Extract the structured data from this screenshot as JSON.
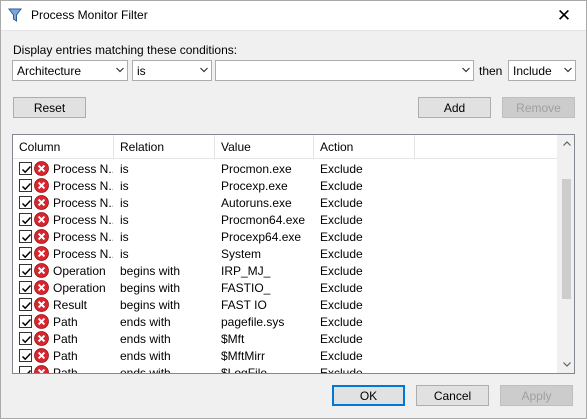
{
  "window": {
    "title": "Process Monitor Filter",
    "close_glyph": "✕",
    "icon": "filter-funnel-icon"
  },
  "filter_bar": {
    "label": "Display entries matching these conditions:",
    "column_value": "Architecture",
    "relation_value": "is",
    "value_text": "",
    "then_label": "then",
    "action_value": "Include"
  },
  "buttons": {
    "reset": "Reset",
    "add": "Add",
    "remove": "Remove",
    "ok": "OK",
    "cancel": "Cancel",
    "apply": "Apply"
  },
  "table": {
    "headers": [
      "Column",
      "Relation",
      "Value",
      "Action"
    ],
    "rows": [
      {
        "checked": true,
        "icon": "exclude-x-icon",
        "column": "Process N...",
        "relation": "is",
        "value": "Procmon.exe",
        "action": "Exclude"
      },
      {
        "checked": true,
        "icon": "exclude-x-icon",
        "column": "Process N...",
        "relation": "is",
        "value": "Procexp.exe",
        "action": "Exclude"
      },
      {
        "checked": true,
        "icon": "exclude-x-icon",
        "column": "Process N...",
        "relation": "is",
        "value": "Autoruns.exe",
        "action": "Exclude"
      },
      {
        "checked": true,
        "icon": "exclude-x-icon",
        "column": "Process N...",
        "relation": "is",
        "value": "Procmon64.exe",
        "action": "Exclude"
      },
      {
        "checked": true,
        "icon": "exclude-x-icon",
        "column": "Process N...",
        "relation": "is",
        "value": "Procexp64.exe",
        "action": "Exclude"
      },
      {
        "checked": true,
        "icon": "exclude-x-icon",
        "column": "Process N...",
        "relation": "is",
        "value": "System",
        "action": "Exclude"
      },
      {
        "checked": true,
        "icon": "exclude-x-icon",
        "column": "Operation",
        "relation": "begins with",
        "value": "IRP_MJ_",
        "action": "Exclude"
      },
      {
        "checked": true,
        "icon": "exclude-x-icon",
        "column": "Operation",
        "relation": "begins with",
        "value": "FASTIO_",
        "action": "Exclude"
      },
      {
        "checked": true,
        "icon": "exclude-x-icon",
        "column": "Result",
        "relation": "begins with",
        "value": "FAST IO",
        "action": "Exclude"
      },
      {
        "checked": true,
        "icon": "exclude-x-icon",
        "column": "Path",
        "relation": "ends with",
        "value": "pagefile.sys",
        "action": "Exclude"
      },
      {
        "checked": true,
        "icon": "exclude-x-icon",
        "column": "Path",
        "relation": "ends with",
        "value": "$Mft",
        "action": "Exclude"
      },
      {
        "checked": true,
        "icon": "exclude-x-icon",
        "column": "Path",
        "relation": "ends with",
        "value": "$MftMirr",
        "action": "Exclude"
      },
      {
        "checked": true,
        "icon": "exclude-x-icon",
        "column": "Path",
        "relation": "ends with",
        "value": "$LogFile",
        "action": "Exclude"
      }
    ]
  },
  "colors": {
    "exclude_icon": "#d9252d",
    "default_button_border": "#0078d7",
    "dialog_background": "#f0f0f0"
  }
}
